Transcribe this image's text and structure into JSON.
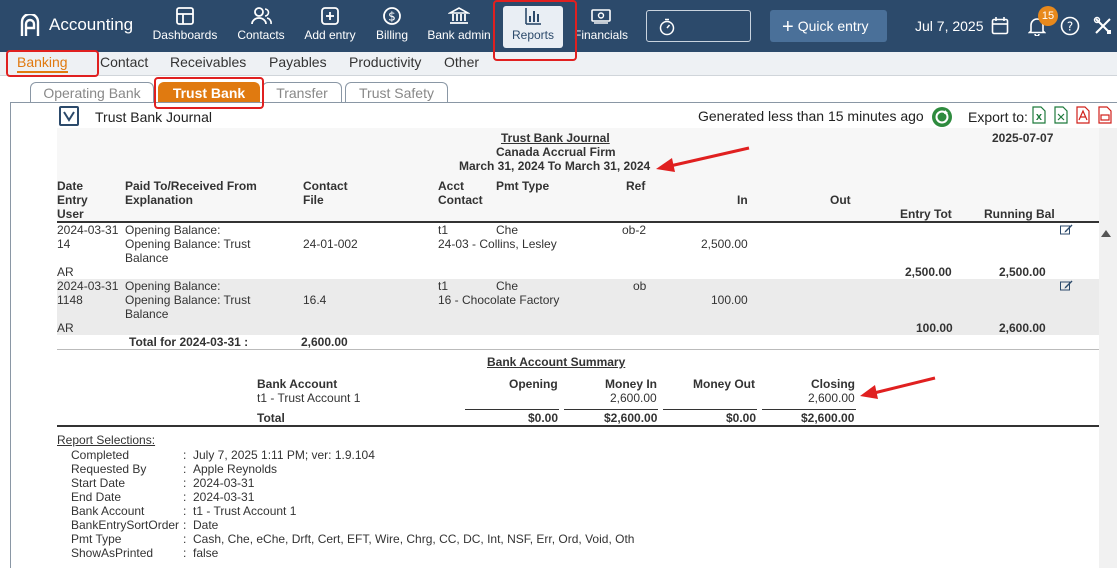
{
  "app": {
    "title": "Accounting"
  },
  "topnav": {
    "items": [
      {
        "label": "Dashboards",
        "icon": "dashboard-icon"
      },
      {
        "label": "Contacts",
        "icon": "contacts-icon"
      },
      {
        "label": "Add entry",
        "icon": "add-entry-icon"
      },
      {
        "label": "Billing",
        "icon": "dollar-icon"
      },
      {
        "label": "Bank admin",
        "icon": "bank-icon"
      },
      {
        "label": "Reports",
        "icon": "bar-chart-icon",
        "active": true
      },
      {
        "label": "Financials",
        "icon": "financials-icon"
      }
    ],
    "quick_entry": "Quick entry",
    "date": "Jul 7, 2025",
    "notifications_count": "15"
  },
  "subnav": {
    "items": [
      "Banking",
      "Contact",
      "Receivables",
      "Payables",
      "Productivity",
      "Other"
    ],
    "active": "Banking"
  },
  "tabs": {
    "items": [
      "Operating Bank",
      "Trust Bank",
      "Transfer",
      "Trust Safety"
    ],
    "active": "Trust Bank"
  },
  "toolbar": {
    "report_name": "Trust Bank Journal",
    "generated": "Generated less than 15 minutes ago",
    "export_label": "Export to:"
  },
  "report": {
    "title": "Trust Bank Journal",
    "firm": "Canada Accrual Firm",
    "period": "March 31, 2024 To March 31, 2024",
    "report_date": "2025-07-07",
    "columns": {
      "date": "Date",
      "entry": "Entry",
      "user": "User",
      "paid_to": "Paid To/Received From",
      "explanation": "Explanation",
      "contact": "Contact",
      "file": "File",
      "acct": "Acct",
      "acct_contact": "Contact",
      "pmt_type": "Pmt Type",
      "ref": "Ref",
      "in": "In",
      "out": "Out",
      "entry_tot": "Entry Tot",
      "running_bal": "Running Bal"
    },
    "rows": [
      {
        "date": "2024-03-31",
        "entry": "14",
        "user": "AR",
        "paid_to": "Opening Balance:",
        "explanation_1": "Opening Balance: Trust",
        "explanation_2": "Balance",
        "file": "24-01-002",
        "acct": "t1",
        "acct_contact": "24-03 - Collins, Lesley",
        "pmt_type": "Che",
        "ref": "ob-2",
        "in": "2,500.00",
        "entry_tot": "2,500.00",
        "running_bal": "2,500.00"
      },
      {
        "date": "2024-03-31",
        "entry": "1148",
        "user": "AR",
        "paid_to": "Opening Balance:",
        "explanation_1": "Opening Balance: Trust",
        "explanation_2": "Balance",
        "file": "16.4",
        "acct": "t1",
        "acct_contact": "16 - Chocolate Factory",
        "pmt_type": "Che",
        "ref": "ob",
        "in": "100.00",
        "entry_tot": "100.00",
        "running_bal": "2,600.00"
      }
    ],
    "total_label": "Total for 2024-03-31 :",
    "total_value": "2,600.00",
    "summary": {
      "title": "Bank Account Summary",
      "headers": {
        "account": "Bank Account",
        "opening": "Opening",
        "money_in": "Money In",
        "money_out": "Money Out",
        "closing": "Closing"
      },
      "row": {
        "account": "t1 - Trust Account 1",
        "money_in": "2,600.00",
        "closing": "2,600.00"
      },
      "total": {
        "label": "Total",
        "opening": "$0.00",
        "money_in": "$2,600.00",
        "money_out": "$0.00",
        "closing": "$2,600.00"
      }
    },
    "selections": {
      "title": "Report Selections:",
      "items": [
        {
          "key": "Completed",
          "value": "July 7, 2025 1:11 PM; ver: 1.9.104"
        },
        {
          "key": "Requested By",
          "value": "Apple Reynolds"
        },
        {
          "key": "Start Date",
          "value": "2024-03-31"
        },
        {
          "key": "End Date",
          "value": "2024-03-31"
        },
        {
          "key": "Bank Account",
          "value": "t1 - Trust Account 1"
        },
        {
          "key": "BankEntrySortOrder",
          "value": "Date"
        },
        {
          "key": "Pmt Type",
          "value": "Cash, Che, eChe, Drft, Cert, EFT, Wire, Chrg, CC, DC, Int, NSF, Err, Ord, Void, Oth"
        },
        {
          "key": "ShowAsPrinted",
          "value": "false"
        }
      ]
    }
  },
  "colors": {
    "topbar": "#2c4a6b",
    "accent_orange": "#e07a10",
    "annotation_red": "#e02020",
    "badge": "#e8891c"
  }
}
